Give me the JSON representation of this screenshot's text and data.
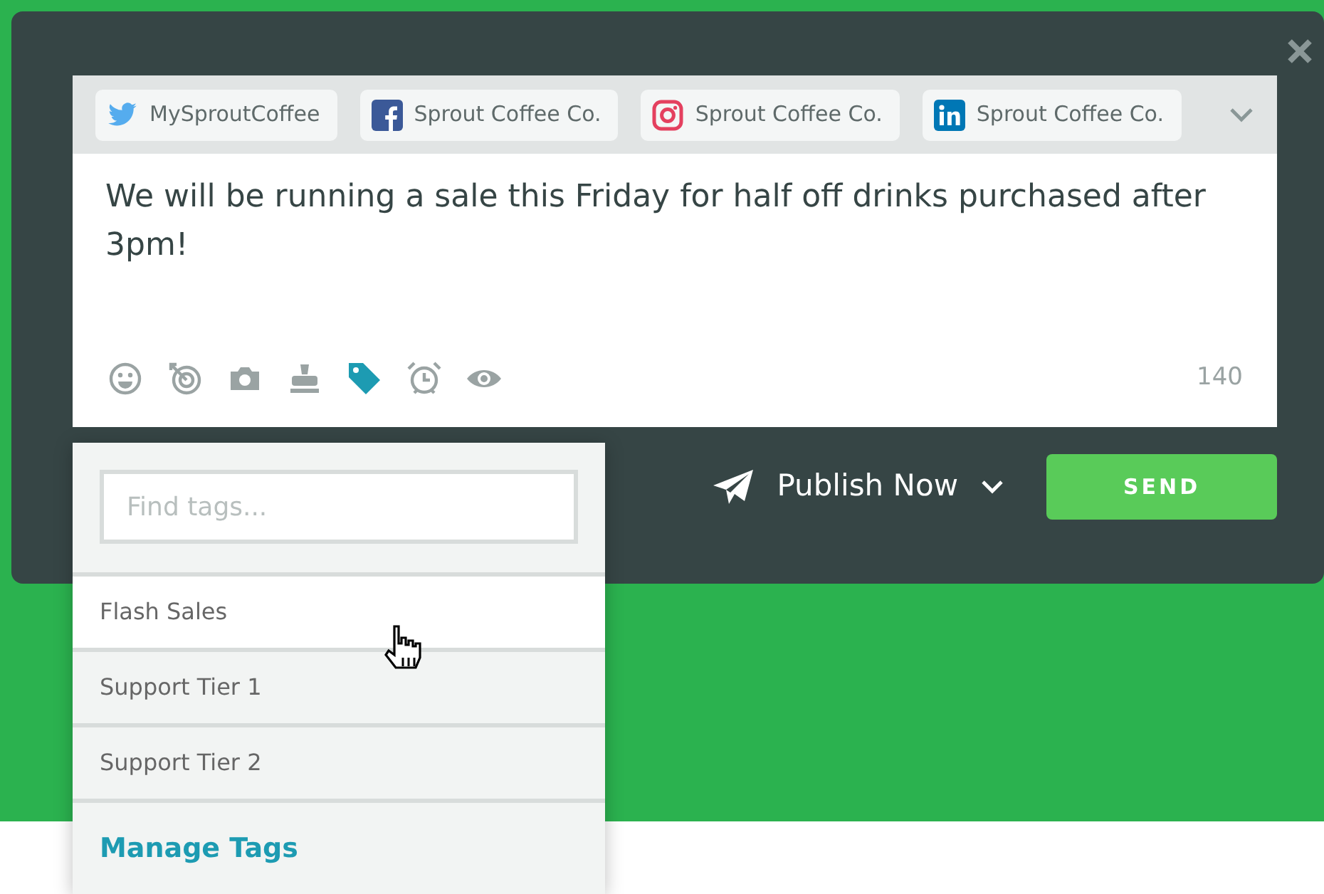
{
  "profiles": [
    {
      "kind": "twitter",
      "name": "MySproutCoffee"
    },
    {
      "kind": "facebook",
      "name": "Sprout Coffee Co."
    },
    {
      "kind": "instagram",
      "name": "Sprout Coffee Co."
    },
    {
      "kind": "linkedin",
      "name": "Sprout Coffee Co."
    }
  ],
  "message": "We will be running a sale this Friday for half off drinks purchased after 3pm!",
  "toolbar": [
    {
      "kind": "emoji",
      "selected": false
    },
    {
      "kind": "target",
      "selected": false
    },
    {
      "kind": "camera",
      "selected": false
    },
    {
      "kind": "stamp",
      "selected": false
    },
    {
      "kind": "tag",
      "selected": true
    },
    {
      "kind": "alarm",
      "selected": false
    },
    {
      "kind": "eye",
      "selected": false
    }
  ],
  "char_count": "140",
  "publish": {
    "label": "Publish Now"
  },
  "send_button": "SEND",
  "tags_dropdown": {
    "placeholder": "Find tags...",
    "items": [
      {
        "label": "Flash Sales",
        "selected": true
      },
      {
        "label": "Support Tier 1",
        "selected": false
      },
      {
        "label": "Support Tier 2",
        "selected": false
      }
    ],
    "manage_link": "Manage Tags"
  }
}
